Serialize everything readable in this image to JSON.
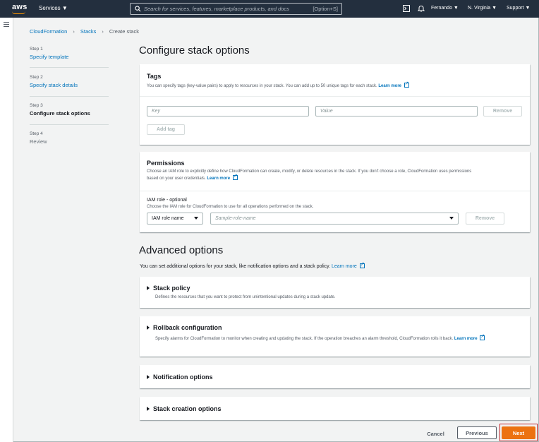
{
  "topnav": {
    "logo": "aws",
    "services": "Services ▼",
    "search_placeholder": "Search for services, features, marketplace products, and docs",
    "search_shortcut": "[Option+S]",
    "user": "Fernando ▼",
    "region": "N. Virginia ▼",
    "support": "Support ▼"
  },
  "breadcrumb": [
    "CloudFormation",
    "Stacks",
    "Create stack"
  ],
  "steps": [
    {
      "num": "Step 1",
      "label": "Specify template"
    },
    {
      "num": "Step 2",
      "label": "Specify stack details"
    },
    {
      "num": "Step 3",
      "label": "Configure stack options"
    },
    {
      "num": "Step 4",
      "label": "Review"
    }
  ],
  "page_title": "Configure stack options",
  "tags": {
    "title": "Tags",
    "desc": "You can specify tags (key-value pairs) to apply to resources in your stack. You can add up to 50 unique tags for each stack.",
    "learn_more": "Learn more",
    "key_placeholder": "Key",
    "value_placeholder": "Value",
    "remove": "Remove",
    "add_tag": "Add tag"
  },
  "permissions": {
    "title": "Permissions",
    "desc1": "Choose an IAM role to explicitly define how CloudFormation can create, modify, or delete resources in the stack. If you don't choose a role, CloudFormation uses permissions",
    "desc2": "based on your user credentials.",
    "learn_more": "Learn more",
    "iam_label": "IAM role - optional",
    "iam_desc": "Choose the IAM role for CloudFormation to use for all operations performed on the stack.",
    "iam_select": "IAM role name",
    "role_placeholder": "Sample-role-name",
    "remove": "Remove"
  },
  "advanced": {
    "title": "Advanced options",
    "desc": "You can set additional options for your stack, like notification options and a stack policy.",
    "learn_more": "Learn more",
    "sections": [
      {
        "title": "Stack policy",
        "desc": "Defines the resources that you want to protect from unintentional updates during a stack update."
      },
      {
        "title": "Rollback configuration",
        "desc": "Specify alarms for CloudFormation to monitor when creating and updating the stack. If the operation breaches an alarm threshold, CloudFormation rolls it back.",
        "learn_more": "Learn",
        "learn_more2": "more"
      },
      {
        "title": "Notification options"
      },
      {
        "title": "Stack creation options"
      }
    ]
  },
  "footer": {
    "cancel": "Cancel",
    "previous": "Previous",
    "next": "Next"
  }
}
